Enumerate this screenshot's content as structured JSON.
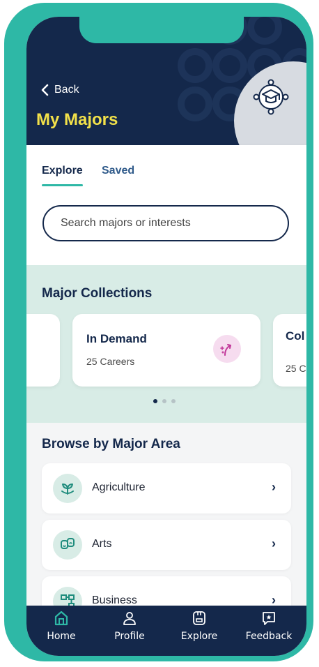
{
  "header": {
    "back_label": "Back",
    "title": "My Majors"
  },
  "tabs": [
    {
      "label": "Explore",
      "active": true
    },
    {
      "label": "Saved",
      "active": false
    }
  ],
  "search": {
    "placeholder": "Search majors or interests",
    "value": ""
  },
  "collections": {
    "title": "Major Collections",
    "cards": [
      {
        "title": "",
        "subtitle": "",
        "icon": "sparkle-icon",
        "partial": "left"
      },
      {
        "title": "In Demand",
        "subtitle": "25 Careers",
        "icon": "trending-sparkle-icon",
        "icon_bg": "#f6dcef",
        "icon_color": "#c2399a"
      },
      {
        "title": "Col",
        "subtitle": "25 C",
        "partial": "right"
      }
    ],
    "pager": {
      "count": 3,
      "active_index": 0
    }
  },
  "browse": {
    "title": "Browse by Major Area",
    "items": [
      {
        "label": "Agriculture",
        "icon": "sprout-icon"
      },
      {
        "label": "Arts",
        "icon": "theater-masks-icon"
      },
      {
        "label": "Business",
        "icon": "org-chart-icon"
      }
    ]
  },
  "nav": {
    "items": [
      {
        "label": "Home",
        "icon": "home-icon",
        "active": true
      },
      {
        "label": "Profile",
        "icon": "person-icon",
        "active": false
      },
      {
        "label": "Explore",
        "icon": "explore-icon",
        "active": false
      },
      {
        "label": "Feedback",
        "icon": "feedback-icon",
        "active": false
      }
    ]
  },
  "colors": {
    "navy": "#14284b",
    "teal": "#2eb8a6",
    "yellow_title": "#f2e14a",
    "mint": "#d8ece6"
  }
}
